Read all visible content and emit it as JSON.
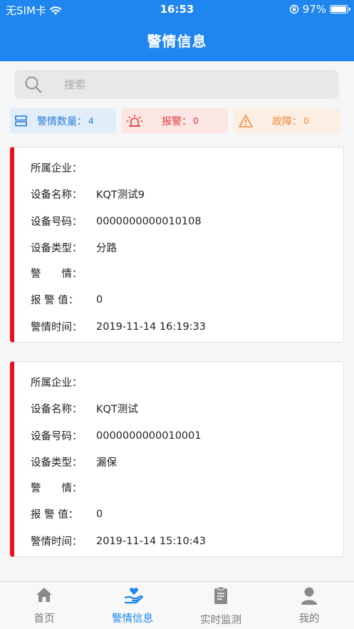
{
  "status_bar": {
    "carrier": "无SIM卡",
    "time": "16:53",
    "battery": "97%",
    "battery_level": 0.97
  },
  "header": {
    "title": "警情信息"
  },
  "search": {
    "placeholder": "搜索"
  },
  "stats": {
    "total": {
      "label": "警情数量：",
      "value": "4"
    },
    "alarm": {
      "label": "报警：",
      "value": "0"
    },
    "fault": {
      "label": "故障：",
      "value": "0"
    }
  },
  "labels": {
    "company": "所属企业：",
    "device_name": "设备名称：",
    "device_number": "设备号码：",
    "device_type": "设备类型：",
    "alert": "警　　情：",
    "alarm_value": "报 警 值：",
    "alert_time": "警情时间："
  },
  "alerts": [
    {
      "company": "",
      "device_name": "KQT测试9",
      "device_number": "0000000000010108",
      "device_type": "分路",
      "alert": "",
      "alarm_value": "0",
      "alert_time": "2019-11-14 16:19:33"
    },
    {
      "company": "",
      "device_name": "KQT测试",
      "device_number": "0000000000010001",
      "device_type": "漏保",
      "alert": "",
      "alarm_value": "0",
      "alert_time": "2019-11-14 15:10:43"
    }
  ],
  "tabbar": [
    {
      "label": "首页",
      "icon": "home-icon"
    },
    {
      "label": "警情信息",
      "icon": "alert-hand-icon"
    },
    {
      "label": "实时监测",
      "icon": "clipboard-icon"
    },
    {
      "label": "我的",
      "icon": "user-icon"
    }
  ],
  "colors": {
    "brand": "#1e86ee",
    "alarm": "#e8111c",
    "fault": "#ef8a3d"
  }
}
